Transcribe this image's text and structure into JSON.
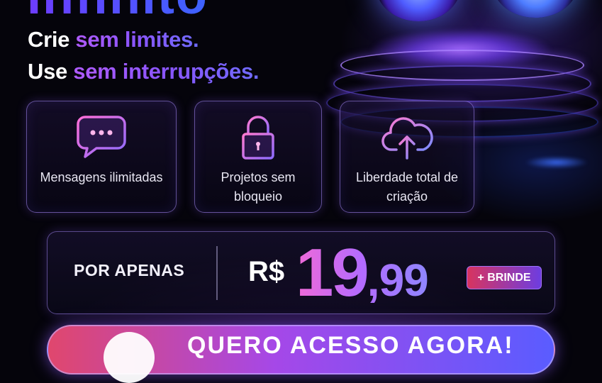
{
  "brand": {
    "word": "Infinito"
  },
  "tagline": {
    "line1_prefix": "Crie ",
    "line1_highlight": "sem limites.",
    "line2_prefix": "Use ",
    "line2_highlight": "sem interrupções."
  },
  "features": [
    {
      "icon": "chat-bubble-icon",
      "label": "Mensagens ilimitadas"
    },
    {
      "icon": "lock-icon",
      "label": "Projetos sem bloqueio"
    },
    {
      "icon": "cloud-upload-icon",
      "label": "Liberdade total de criação"
    }
  ],
  "pricing": {
    "prefix": "POR APENAS",
    "currency": "R$",
    "whole": "19",
    "cents": ",99",
    "badge": "+ BRINDE"
  },
  "cta": {
    "label": "QUERO ACESSO AGORA!"
  },
  "colors": {
    "background": "#05040b",
    "accent_purple": "#8a55ff",
    "accent_pink": "#f06ad8",
    "badge_red": "#d8345f"
  }
}
